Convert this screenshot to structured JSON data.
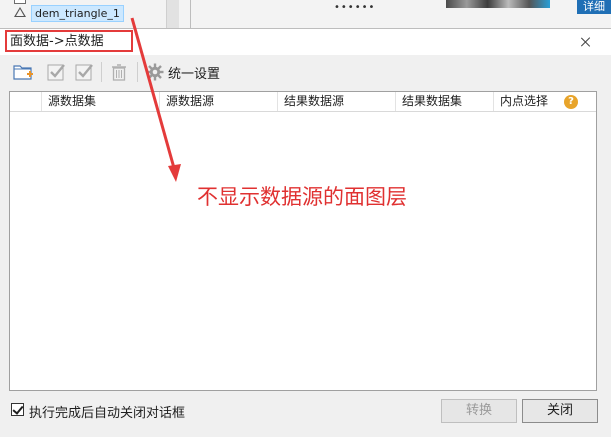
{
  "background": {
    "tree_selected_label": "dem_triangle_1",
    "masked_text": "••••••",
    "top_right_button": "详细"
  },
  "dialog": {
    "title": "面数据->点数据",
    "toolbar": {
      "settings_label": "统一设置"
    },
    "table": {
      "columns": [
        "源数据集",
        "源数据源",
        "结果数据源",
        "结果数据集",
        "内点选择"
      ],
      "rows": []
    },
    "annotation": "不显示数据源的面图层",
    "footer": {
      "auto_close_label": "执行完成后自动关闭对话框",
      "auto_close_checked": true,
      "convert_label": "转换",
      "close_label": "关闭"
    }
  },
  "colors": {
    "highlight_red": "#e43b3b",
    "annotation_red": "#e03131",
    "help_orange": "#e8a42a",
    "selection_blue": "#cce8ff"
  }
}
